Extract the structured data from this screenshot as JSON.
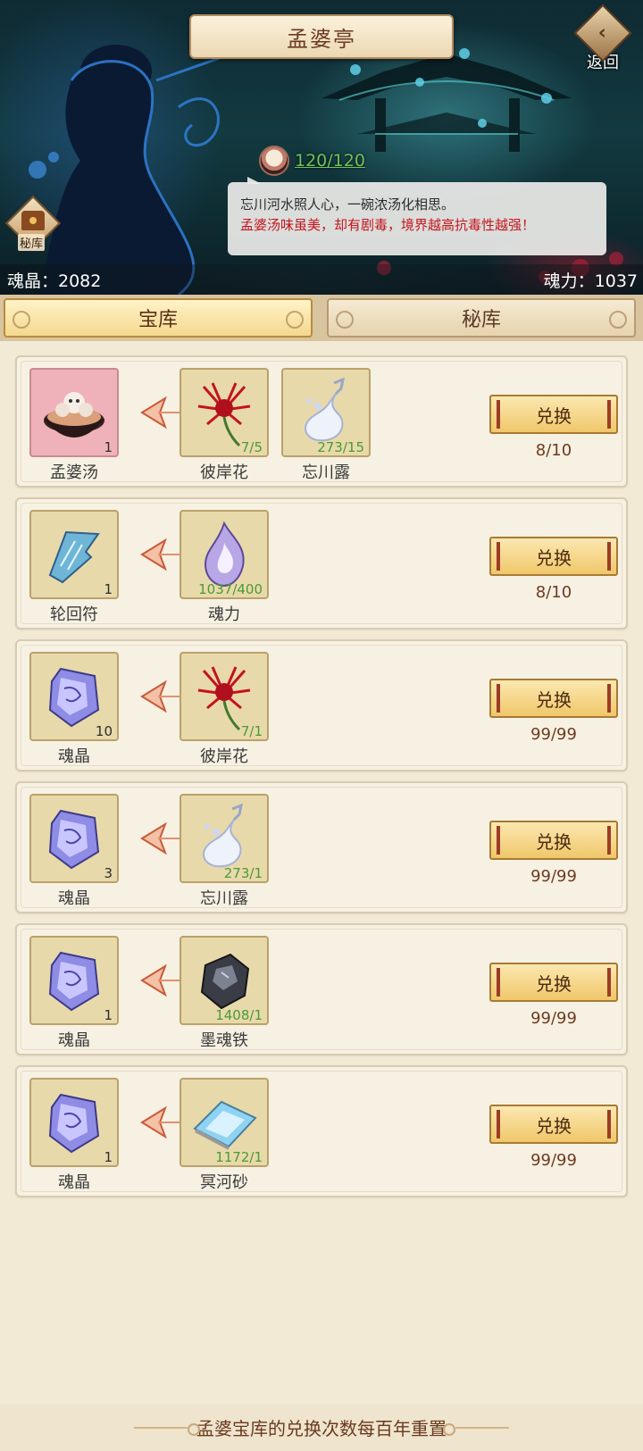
{
  "header": {
    "title": "孟婆亭",
    "back_label": "返回",
    "soup_counter": "120/120",
    "dialog_line1": "忘川河水照人心，一碗浓汤化相思。",
    "dialog_line2": "孟婆汤味虽美，却有剧毒，境界越高抗毒性越强！",
    "secret_label": "秘库",
    "soul_crystal_text": "魂晶：2082",
    "soul_power_text": "魂力：1037"
  },
  "tabs": [
    {
      "label": "宝库",
      "active": true
    },
    {
      "label": "秘库",
      "active": false
    }
  ],
  "exchange_label": "兑换",
  "rows": [
    {
      "reward": {
        "name": "孟婆汤",
        "count": "1",
        "icon": "soup-bowl-icon"
      },
      "costs": [
        {
          "name": "彼岸花",
          "count": "7/5",
          "icon": "red-spider-lily-icon"
        },
        {
          "name": "忘川露",
          "count": "273/15",
          "icon": "dew-vase-icon"
        }
      ],
      "limit": "8/10"
    },
    {
      "reward": {
        "name": "轮回符",
        "count": "1",
        "icon": "talisman-icon"
      },
      "costs": [
        {
          "name": "魂力",
          "count": "1037/400",
          "icon": "soul-flame-icon"
        }
      ],
      "limit": "8/10"
    },
    {
      "reward": {
        "name": "魂晶",
        "count": "10",
        "icon": "soul-crystal-icon"
      },
      "costs": [
        {
          "name": "彼岸花",
          "count": "7/1",
          "icon": "red-spider-lily-icon"
        }
      ],
      "limit": "99/99"
    },
    {
      "reward": {
        "name": "魂晶",
        "count": "3",
        "icon": "soul-crystal-icon"
      },
      "costs": [
        {
          "name": "忘川露",
          "count": "273/1",
          "icon": "dew-vase-icon"
        }
      ],
      "limit": "99/99"
    },
    {
      "reward": {
        "name": "魂晶",
        "count": "1",
        "icon": "soul-crystal-icon"
      },
      "costs": [
        {
          "name": "墨魂铁",
          "count": "1408/1",
          "icon": "dark-iron-ore-icon"
        }
      ],
      "limit": "99/99"
    },
    {
      "reward": {
        "name": "魂晶",
        "count": "1",
        "icon": "soul-crystal-icon"
      },
      "costs": [
        {
          "name": "冥河砂",
          "count": "1172/1",
          "icon": "river-sand-icon"
        }
      ],
      "limit": "99/99"
    }
  ],
  "footer_text": "孟婆宝库的兑换次数每百年重置"
}
